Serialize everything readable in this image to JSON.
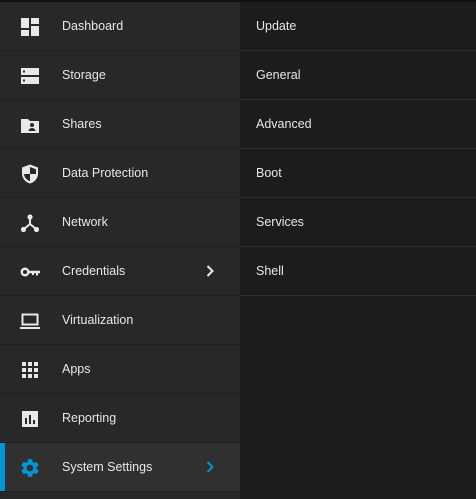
{
  "sidebar": {
    "items": [
      {
        "label": "Dashboard",
        "icon": "dashboard-icon"
      },
      {
        "label": "Storage",
        "icon": "storage-icon"
      },
      {
        "label": "Shares",
        "icon": "shares-icon"
      },
      {
        "label": "Data Protection",
        "icon": "shield-icon"
      },
      {
        "label": "Network",
        "icon": "network-icon"
      },
      {
        "label": "Credentials",
        "icon": "key-icon"
      },
      {
        "label": "Virtualization",
        "icon": "laptop-icon"
      },
      {
        "label": "Apps",
        "icon": "apps-grid-icon"
      },
      {
        "label": "Reporting",
        "icon": "reporting-icon"
      },
      {
        "label": "System Settings",
        "icon": "gear-icon",
        "active": true
      }
    ],
    "accent_color": "#0095d5"
  },
  "submenu": {
    "items": [
      {
        "label": "Update"
      },
      {
        "label": "General"
      },
      {
        "label": "Advanced"
      },
      {
        "label": "Boot"
      },
      {
        "label": "Services"
      },
      {
        "label": "Shell"
      }
    ]
  }
}
